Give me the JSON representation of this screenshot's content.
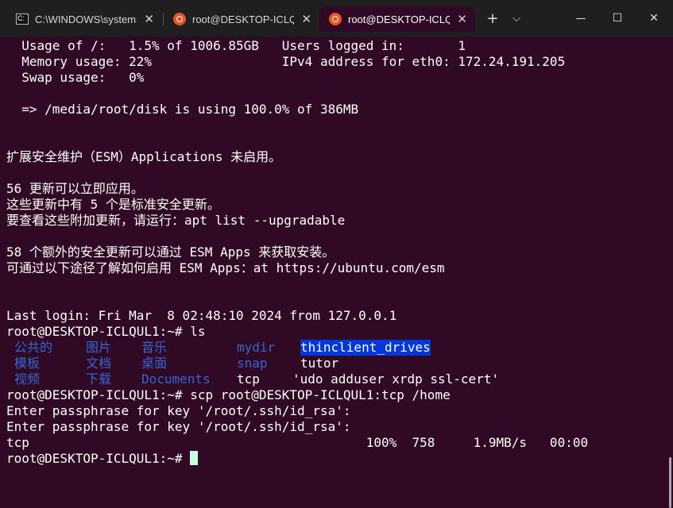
{
  "tabs": [
    {
      "label": "C:\\WINDOWS\\system32\\cmd.exe",
      "icon": "cmd-icon"
    },
    {
      "label": "root@DESKTOP-ICLQUL1: ~",
      "icon": "ubuntu-icon"
    },
    {
      "label": "root@DESKTOP-ICLQUL1: ~",
      "icon": "ubuntu-icon"
    }
  ],
  "titlebar": {
    "new_tab": "+",
    "dropdown": "⌵",
    "minimize": "—",
    "maximize": "☐",
    "close": "✕",
    "tab_close": "✕"
  },
  "terminal": {
    "lines": [
      "  Usage of /:   1.5% of 1006.85GB   Users logged in:       1",
      "  Memory usage: 22%                 IPv4 address for eth0: 172.24.191.205",
      "  Swap usage:   0%",
      "",
      "  => /media/root/disk is using 100.0% of 386MB",
      "",
      "",
      "扩展安全维护（ESM）Applications 未启用。",
      "",
      "56 更新可以立即应用。",
      "这些更新中有 5 个是标准安全更新。",
      "要查看这些附加更新，请运行：apt list --upgradable",
      "",
      "58 个额外的安全更新可以通过 ESM Apps 来获取安装。",
      "可通过以下途径了解如何启用 ESM Apps：at https://ubuntu.com/esm",
      "",
      "",
      "Last login: Fri Mar  8 02:48:10 2024 from 127.0.0.1",
      "root@DESKTOP-ICLQUL1:~# ls"
    ],
    "ls_output": [
      [
        "公共的",
        "图片",
        "音乐",
        "mydir",
        "thinclient_drives"
      ],
      [
        "模板",
        "文档",
        "桌面",
        "snap",
        "tutor"
      ],
      [
        "视频",
        "下载",
        "Documents",
        "tcp",
        "'udo adduser xrdp ssl-cert'"
      ]
    ],
    "after_lines": [
      "root@DESKTOP-ICLQUL1:~# scp root@DESKTOP-ICLQUL1:tcp /home",
      "Enter passphrase for key '/root/.ssh/id_rsa':",
      "Enter passphrase for key '/root/.ssh/id_rsa':",
      "tcp                                            100%  758     1.9MB/s   00:00",
      "root@DESKTOP-ICLQUL1:~# "
    ]
  }
}
